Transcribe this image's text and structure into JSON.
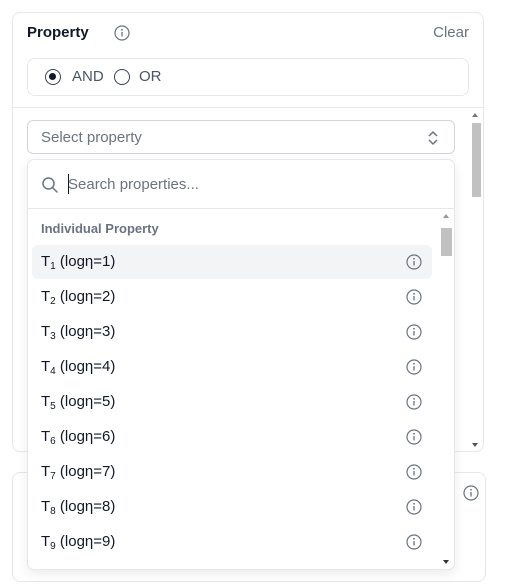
{
  "header": {
    "title": "Property",
    "clear_label": "Clear"
  },
  "logic": {
    "and_label": "AND",
    "or_label": "OR",
    "selected": "AND"
  },
  "select": {
    "placeholder": "Select property"
  },
  "dropdown": {
    "search_placeholder": "Search properties...",
    "group_label": "Individual Property",
    "options": [
      {
        "base": "T",
        "sub": "1",
        "rest": " (logη=1)"
      },
      {
        "base": "T",
        "sub": "2",
        "rest": " (logη=2)"
      },
      {
        "base": "T",
        "sub": "3",
        "rest": " (logη=3)"
      },
      {
        "base": "T",
        "sub": "4",
        "rest": " (logη=4)"
      },
      {
        "base": "T",
        "sub": "5",
        "rest": " (logη=5)"
      },
      {
        "base": "T",
        "sub": "6",
        "rest": " (logη=6)"
      },
      {
        "base": "T",
        "sub": "7",
        "rest": " (logη=7)"
      },
      {
        "base": "T",
        "sub": "8",
        "rest": " (logη=8)"
      },
      {
        "base": "T",
        "sub": "9",
        "rest": " (logη=9)"
      }
    ]
  },
  "icons": {
    "info": "info-circle-icon",
    "search": "search-icon",
    "chevrons": "chevron-up-down-icon"
  },
  "colors": {
    "muted_text": "#6b7280",
    "border": "#e5e7eb",
    "hover_bg": "#f3f4f6"
  }
}
